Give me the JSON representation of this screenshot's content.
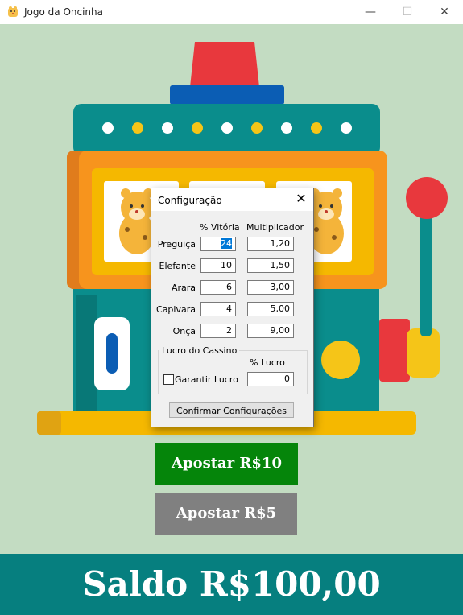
{
  "window": {
    "title": "Jogo da Oncinha",
    "minimize": "—",
    "maximize": "☐",
    "close": "✕"
  },
  "bets": {
    "bet10": "Apostar R$10",
    "bet5": "Apostar R$5"
  },
  "balance": "Saldo R$100,00",
  "dialog": {
    "title": "Configuração",
    "close": "✕",
    "headers": {
      "win": "% Vitória",
      "mult": "Multiplicador"
    },
    "rows": [
      {
        "name": "Preguiça",
        "win": "24",
        "mult": "1,20"
      },
      {
        "name": "Elefante",
        "win": "10",
        "mult": "1,50"
      },
      {
        "name": "Arara",
        "win": "6",
        "mult": "3,00"
      },
      {
        "name": "Capivara",
        "win": "4",
        "mult": "5,00"
      },
      {
        "name": "Onça",
        "win": "2",
        "mult": "9,00"
      }
    ],
    "profit": {
      "group": "Lucro do Cassino",
      "header": "% Lucro",
      "checkbox": "Garantir Lucro",
      "value": "0",
      "checked": false
    },
    "confirm": "Confirmar Configurações"
  },
  "colors": {
    "bg": "#c3dcc2",
    "machine": "#0a8d8c",
    "orange": "#f7941d",
    "bet10": "#05850a",
    "bet5": "#808080",
    "balance": "#067f7f"
  }
}
